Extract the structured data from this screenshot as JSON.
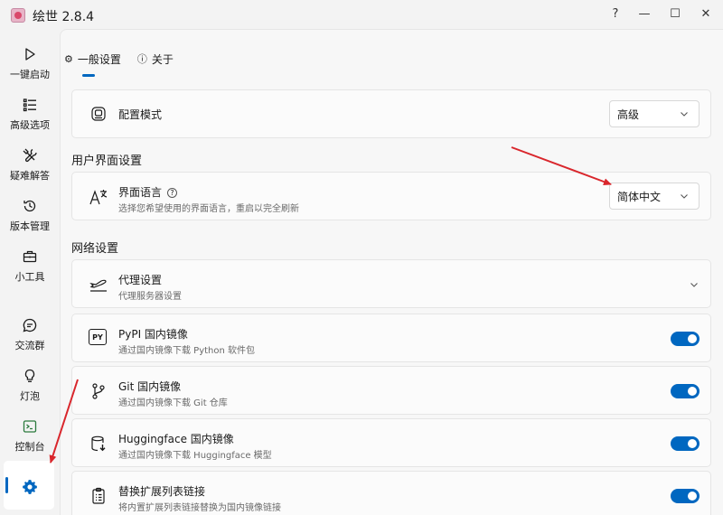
{
  "window": {
    "title": "绘世 2.8.4",
    "help_glyph": "?",
    "minimize_glyph": "—",
    "maximize_glyph": "☐",
    "close_glyph": "✕"
  },
  "sidebar": {
    "items": [
      {
        "label": "一键启动",
        "icon": "play-icon"
      },
      {
        "label": "高级选项",
        "icon": "list-icon"
      },
      {
        "label": "疑难解答",
        "icon": "tools-icon"
      },
      {
        "label": "版本管理",
        "icon": "history-icon"
      },
      {
        "label": "小工具",
        "icon": "toolbox-icon"
      },
      {
        "label": "交流群",
        "icon": "chat-icon"
      },
      {
        "label": "灯泡",
        "icon": "bulb-icon"
      },
      {
        "label": "控制台",
        "icon": "console-icon"
      },
      {
        "label": "",
        "icon": "gear-icon",
        "selected": true
      }
    ]
  },
  "tabs": [
    {
      "label": "一般设置",
      "icon": "settings-icon",
      "active": true
    },
    {
      "label": "关于",
      "icon": "info-icon"
    }
  ],
  "config_mode": {
    "title": "配置模式",
    "value": "高级"
  },
  "ui_section": {
    "header": "用户界面设置",
    "language": {
      "title": "界面语言",
      "desc": "选择您希望使用的界面语言，重启以完全刷新",
      "value": "简体中文"
    }
  },
  "network_section": {
    "header": "网络设置",
    "proxy": {
      "title": "代理设置",
      "desc": "代理服务器设置"
    },
    "pypi": {
      "title": "PyPI 国内镜像",
      "desc": "通过国内镜像下载 Python 软件包",
      "enabled": true,
      "icon_text": "PY"
    },
    "git": {
      "title": "Git 国内镜像",
      "desc": "通过国内镜像下载 Git 仓库",
      "enabled": true
    },
    "huggingface": {
      "title": "Huggingface 国内镜像",
      "desc": "通过国内镜像下载 Huggingface 模型",
      "enabled": true
    },
    "ext_list": {
      "title": "替换扩展列表链接",
      "desc": "将内置扩展列表链接替换为国内镜像链接",
      "enabled": true
    }
  },
  "colors": {
    "accent": "#0067c0",
    "arrow": "#d9262c"
  }
}
